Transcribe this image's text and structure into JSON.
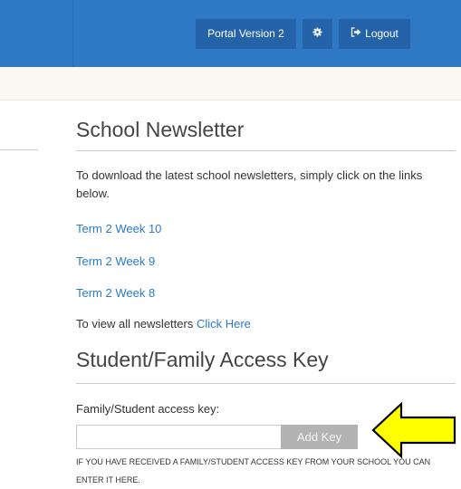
{
  "header": {
    "portal_label": "Portal Version 2",
    "settings_icon": "gear-icon",
    "logout_icon": "sign-out-icon",
    "logout_label": "Logout",
    "bar_color": "#2f78c4",
    "button_color": "#2563a9"
  },
  "newsletter": {
    "title": "School Newsletter",
    "intro": "To download the latest school newsletters, simply click on the links below.",
    "links": [
      {
        "label": "Term 2 Week 10"
      },
      {
        "label": "Term 2 Week 9"
      },
      {
        "label": "Term 2 Week 8"
      }
    ],
    "view_all_text": "To view all newsletters",
    "view_all_link": "Click Here",
    "link_color": "#2a7ac9"
  },
  "access_key": {
    "title": "Student/Family Access Key",
    "field_label": "Family/Student access key:",
    "input_value": "",
    "button_label": "Add Key",
    "note": "IF YOU HAVE RECEIVED A FAMILY/STUDENT ACCESS KEY FROM YOUR SCHOOL YOU CAN ENTER IT HERE."
  },
  "annotation": {
    "icon": "yellow-arrow-icon",
    "fill": "#ffff00"
  }
}
